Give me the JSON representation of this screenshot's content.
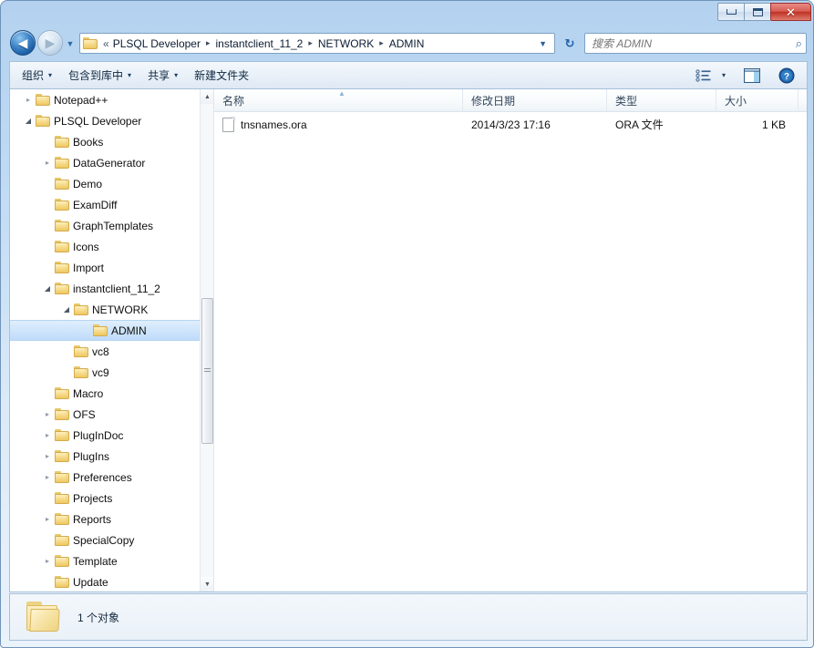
{
  "window": {
    "controls": {
      "minimize_label": "—",
      "maximize_label": "□",
      "close_label": "✕"
    }
  },
  "nav": {
    "back_label": "◀",
    "forward_label": "▶",
    "history_dropdown_label": "▼",
    "refresh_label": "↻",
    "address_prefix": "«",
    "breadcrumbs": [
      "PLSQL Developer",
      "instantclient_11_2",
      "NETWORK",
      "ADMIN"
    ],
    "separator": "▸",
    "address_dropdown_label": "▼"
  },
  "search": {
    "placeholder": "搜索 ADMIN",
    "value": "",
    "icon_label": "⌕"
  },
  "toolbar": {
    "items": [
      {
        "label": "组织",
        "caret": "▾"
      },
      {
        "label": "包含到库中",
        "caret": "▾"
      },
      {
        "label": "共享",
        "caret": "▾"
      },
      {
        "label": "新建文件夹",
        "caret": ""
      }
    ],
    "view_caret": "▾"
  },
  "tree": {
    "items": [
      {
        "label": "Notepad++",
        "indent": 1,
        "expander": "collapsed",
        "selected": false
      },
      {
        "label": "PLSQL Developer",
        "indent": 1,
        "expander": "expanded",
        "selected": false
      },
      {
        "label": "Books",
        "indent": 2,
        "expander": "none",
        "selected": false
      },
      {
        "label": "DataGenerator",
        "indent": 2,
        "expander": "collapsed",
        "selected": false
      },
      {
        "label": "Demo",
        "indent": 2,
        "expander": "none",
        "selected": false
      },
      {
        "label": "ExamDiff",
        "indent": 2,
        "expander": "none",
        "selected": false
      },
      {
        "label": "GraphTemplates",
        "indent": 2,
        "expander": "none",
        "selected": false
      },
      {
        "label": "Icons",
        "indent": 2,
        "expander": "none",
        "selected": false
      },
      {
        "label": "Import",
        "indent": 2,
        "expander": "none",
        "selected": false
      },
      {
        "label": "instantclient_11_2",
        "indent": 2,
        "expander": "expanded",
        "selected": false
      },
      {
        "label": "NETWORK",
        "indent": 3,
        "expander": "expanded",
        "selected": false
      },
      {
        "label": "ADMIN",
        "indent": 4,
        "expander": "none",
        "selected": true
      },
      {
        "label": "vc8",
        "indent": 3,
        "expander": "none",
        "selected": false
      },
      {
        "label": "vc9",
        "indent": 3,
        "expander": "none",
        "selected": false
      },
      {
        "label": "Macro",
        "indent": 2,
        "expander": "none",
        "selected": false
      },
      {
        "label": "OFS",
        "indent": 2,
        "expander": "collapsed",
        "selected": false
      },
      {
        "label": "PlugInDoc",
        "indent": 2,
        "expander": "collapsed",
        "selected": false
      },
      {
        "label": "PlugIns",
        "indent": 2,
        "expander": "collapsed",
        "selected": false
      },
      {
        "label": "Preferences",
        "indent": 2,
        "expander": "collapsed",
        "selected": false
      },
      {
        "label": "Projects",
        "indent": 2,
        "expander": "none",
        "selected": false
      },
      {
        "label": "Reports",
        "indent": 2,
        "expander": "collapsed",
        "selected": false
      },
      {
        "label": "SpecialCopy",
        "indent": 2,
        "expander": "none",
        "selected": false
      },
      {
        "label": "Template",
        "indent": 2,
        "expander": "collapsed",
        "selected": false
      },
      {
        "label": "Update",
        "indent": 2,
        "expander": "none",
        "selected": false
      }
    ],
    "scrollbar": {
      "up_label": "▲",
      "down_label": "▼"
    }
  },
  "list": {
    "columns": [
      {
        "key": "name",
        "label": "名称",
        "sorted": "asc"
      },
      {
        "key": "date",
        "label": "修改日期",
        "sorted": ""
      },
      {
        "key": "type",
        "label": "类型",
        "sorted": ""
      },
      {
        "key": "size",
        "label": "大小",
        "sorted": ""
      }
    ],
    "sort_mark": "▲",
    "rows": [
      {
        "name": "tnsnames.ora",
        "date": "2014/3/23 17:16",
        "type": "ORA 文件",
        "size": "1 KB"
      }
    ]
  },
  "status": {
    "text": "1 个对象"
  }
}
